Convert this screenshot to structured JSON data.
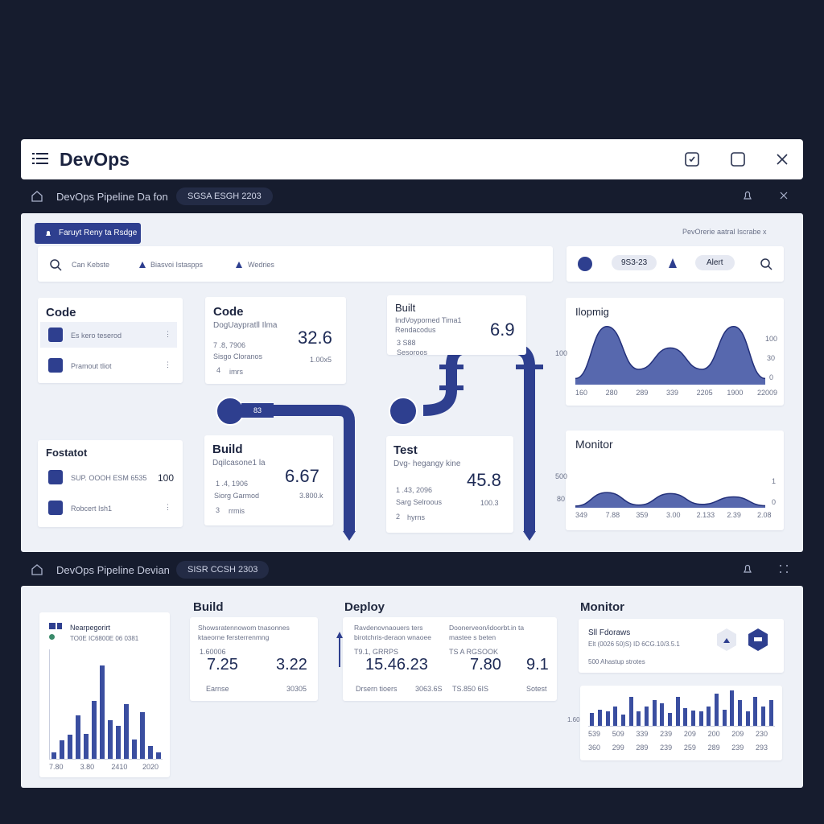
{
  "window": {
    "title": "DevOps"
  },
  "strip1": {
    "label": "DevOps Pipeline Da fon",
    "pill": "SGSA ESGH 2203"
  },
  "strip2": {
    "label": "DevOps Pipeline Devian",
    "pill": "SISR CCSH 2303"
  },
  "top_panel": {
    "badge": "Faruyt Reny ta Rsdge",
    "right_note": "PevOrerie aatral Iscrabe x",
    "search": {
      "item1": "Can Kebste",
      "item2": "Biasvoi Istaspps",
      "item3": "Wedries"
    },
    "toolbar": {
      "pill": "9S3-23",
      "alert": "Alert"
    },
    "code_list": {
      "title": "Code",
      "item1": "Es kero teserod",
      "item2": "Pramout tliot"
    },
    "footer_list": {
      "title": "Fostatot",
      "item1": "SUP. OOOH ESM 6535",
      "item1_value": "100",
      "item2": "Robcert Ish1"
    },
    "code_card": {
      "title": "Code",
      "subtitle": "DogUaypratll Ilma",
      "value": "32.6",
      "l1": "7 .8, 7906",
      "l2": "Sisgo Cloranos",
      "r2": "1.00x5",
      "l3": "4",
      "l3b": "imrs"
    },
    "build_top": {
      "title": "Built",
      "subtitle": "IndVoyporned Tima1",
      "sub2": "Rendacodus",
      "value": "6.9",
      "l1": "3 S88",
      "l2": "Sesoroos"
    },
    "build_card": {
      "title": "Build",
      "subtitle": "Dqilcasone1 la",
      "value": "6.67",
      "l1": "1 .4, 1906",
      "l2": "Siorg Garmod",
      "r2": "3.800.k",
      "l3": "3",
      "l3b": "rrmis"
    },
    "test_card": {
      "title": "Test",
      "subtitle": "Dvg- hegangy kine",
      "value": "45.8",
      "l1": "1 .43, 2096",
      "l2": "Sarg Selroous",
      "r2": "100.3",
      "l3": "2",
      "l3b": "hyrns"
    },
    "node1_label": "83",
    "chart_top": {
      "title": "Ilopmig",
      "ylab_left": "100",
      "ylab_r1": "100",
      "ylab_r2": "30",
      "ylab_r3": "0",
      "x": [
        "160",
        "280",
        "289",
        "339",
        "2205",
        "1900",
        "22009"
      ]
    },
    "chart_monitor": {
      "title": "Monitor",
      "yl1": "500",
      "yl2": "80",
      "yr1": "1",
      "yr2": "0",
      "x": [
        "349",
        "7.88",
        "359",
        "3.00",
        "2.133",
        "2.39",
        "2.08"
      ]
    }
  },
  "bottom_panel": {
    "left_card": {
      "title": "Nearpegorirt",
      "sub": "TO0E IC6800E 06 0381",
      "x": [
        "7.80",
        "3.80",
        "2410",
        "2020"
      ]
    },
    "build": {
      "title": "Build",
      "line1": "Showsratennowom tnasonnes",
      "line2": "ktaeorne fersterrenmng",
      "small": "1.60006",
      "v1": "7.25",
      "v2": "3.22",
      "f1": "Earnse",
      "f2": "30305"
    },
    "deploy": {
      "title": "Deploy",
      "line1": "Ravdenovnaouers ters",
      "line2": "birotchris-deraon wnaoee",
      "line3": "Doonerveon/idoorbt.in ta",
      "line4": "mastee s beten",
      "s1": "T9.1, GRRPS",
      "s2": "TS A RGSOOK",
      "v1": "15.46.23",
      "v2": "7.80",
      "v3": "9.1",
      "f1": "Drsern tioers",
      "f2": "3063.6S",
      "f3": "TS.850 6IS",
      "f4": "Sotest"
    },
    "monitor": {
      "title": "Monitor",
      "card_title": "Sll Fdoraws",
      "card_sub": "Elt (0026 50)S) ID 6CG.10/3.5.1",
      "card_sub2": "500 Ahastup strotes",
      "chart_y": "1.60",
      "x1": [
        "539",
        "509",
        "339",
        "239",
        "209",
        "200",
        "209",
        "230"
      ],
      "x2": [
        "360",
        "299",
        "289",
        "239",
        "259",
        "289",
        "239",
        "293"
      ]
    }
  },
  "chart_data": [
    {
      "type": "area",
      "title": "Ilopmig",
      "x": [
        "160",
        "280",
        "289",
        "339",
        "2205",
        "1900",
        "22009"
      ],
      "values": [
        10,
        95,
        25,
        60,
        25,
        95,
        10
      ]
    },
    {
      "type": "area",
      "title": "Monitor",
      "x": [
        "349",
        "7.88",
        "359",
        "3.00",
        "2.133",
        "2.39",
        "2.08"
      ],
      "values": [
        5,
        45,
        8,
        42,
        10,
        32,
        6
      ]
    },
    {
      "type": "bar",
      "title": "Nearpegorirt",
      "x": [
        "7.80",
        "3.80",
        "2410",
        "2020"
      ],
      "values": [
        6,
        17,
        22,
        40,
        23,
        53,
        85,
        35,
        30,
        50,
        18,
        43,
        12,
        6
      ]
    },
    {
      "type": "bar",
      "title": "Monitor",
      "values": [
        20,
        25,
        22,
        30,
        18,
        45,
        22,
        30,
        40,
        35,
        20,
        45,
        28,
        24,
        22,
        30,
        50,
        25,
        55,
        40,
        22,
        45,
        30,
        40
      ]
    }
  ]
}
